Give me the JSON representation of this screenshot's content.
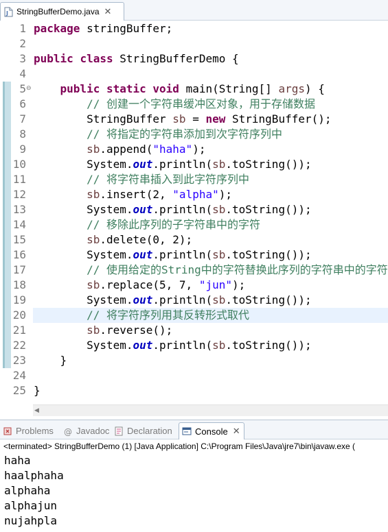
{
  "editor": {
    "tab_title": "StringBufferDemo.java",
    "tab_close": "✕",
    "current_line": 20,
    "lines": [
      [
        {
          "t": "package",
          "c": "kw"
        },
        {
          "t": " stringBuffer;"
        }
      ],
      [],
      [
        {
          "t": "public",
          "c": "kw"
        },
        {
          "t": " "
        },
        {
          "t": "class",
          "c": "kw"
        },
        {
          "t": " StringBufferDemo {"
        }
      ],
      [],
      [
        {
          "t": "    "
        },
        {
          "t": "public",
          "c": "kw"
        },
        {
          "t": " "
        },
        {
          "t": "static",
          "c": "kw"
        },
        {
          "t": " "
        },
        {
          "t": "void",
          "c": "kw"
        },
        {
          "t": " main(String[] "
        },
        {
          "t": "args",
          "c": "var"
        },
        {
          "t": ") {"
        }
      ],
      [
        {
          "t": "        "
        },
        {
          "t": "// 创建一个字符串缓冲区对象，用于存储数据",
          "c": "cm"
        }
      ],
      [
        {
          "t": "        StringBuffer "
        },
        {
          "t": "sb",
          "c": "var"
        },
        {
          "t": " = "
        },
        {
          "t": "new",
          "c": "kw"
        },
        {
          "t": " StringBuffer();"
        }
      ],
      [
        {
          "t": "        "
        },
        {
          "t": "// 将指定的字符串添加到次字符序列中",
          "c": "cm"
        }
      ],
      [
        {
          "t": "        "
        },
        {
          "t": "sb",
          "c": "var"
        },
        {
          "t": ".append("
        },
        {
          "t": "\"haha\"",
          "c": "st"
        },
        {
          "t": ");"
        }
      ],
      [
        {
          "t": "        System."
        },
        {
          "t": "out",
          "c": "fld"
        },
        {
          "t": ".println("
        },
        {
          "t": "sb",
          "c": "var"
        },
        {
          "t": ".toString());"
        }
      ],
      [
        {
          "t": "        "
        },
        {
          "t": "// 将字符串插入到此字符序列中",
          "c": "cm"
        }
      ],
      [
        {
          "t": "        "
        },
        {
          "t": "sb",
          "c": "var"
        },
        {
          "t": ".insert(2, "
        },
        {
          "t": "\"alpha\"",
          "c": "st"
        },
        {
          "t": ");"
        }
      ],
      [
        {
          "t": "        System."
        },
        {
          "t": "out",
          "c": "fld"
        },
        {
          "t": ".println("
        },
        {
          "t": "sb",
          "c": "var"
        },
        {
          "t": ".toString());"
        }
      ],
      [
        {
          "t": "        "
        },
        {
          "t": "// 移除此序列的子字符串中的字符",
          "c": "cm"
        }
      ],
      [
        {
          "t": "        "
        },
        {
          "t": "sb",
          "c": "var"
        },
        {
          "t": ".delete(0, 2);"
        }
      ],
      [
        {
          "t": "        System."
        },
        {
          "t": "out",
          "c": "fld"
        },
        {
          "t": ".println("
        },
        {
          "t": "sb",
          "c": "var"
        },
        {
          "t": ".toString());"
        }
      ],
      [
        {
          "t": "        "
        },
        {
          "t": "// 使用给定的String中的字符替换此序列的字符串中的字符",
          "c": "cm"
        }
      ],
      [
        {
          "t": "        "
        },
        {
          "t": "sb",
          "c": "var"
        },
        {
          "t": ".replace(5, 7, "
        },
        {
          "t": "\"jun\"",
          "c": "st"
        },
        {
          "t": ");"
        }
      ],
      [
        {
          "t": "        System."
        },
        {
          "t": "out",
          "c": "fld"
        },
        {
          "t": ".println("
        },
        {
          "t": "sb",
          "c": "var"
        },
        {
          "t": ".toString());"
        }
      ],
      [
        {
          "t": "        "
        },
        {
          "t": "// 将字符序列用其反转形式取代",
          "c": "cm"
        }
      ],
      [
        {
          "t": "        "
        },
        {
          "t": "sb",
          "c": "var"
        },
        {
          "t": ".reverse();"
        }
      ],
      [
        {
          "t": "        System."
        },
        {
          "t": "out",
          "c": "fld"
        },
        {
          "t": ".println("
        },
        {
          "t": "sb",
          "c": "var"
        },
        {
          "t": ".toString());"
        }
      ],
      [
        {
          "t": "    }"
        }
      ],
      [],
      [
        {
          "t": "}"
        }
      ]
    ]
  },
  "views": {
    "tabs": [
      {
        "label": "Problems",
        "icon": "problems-icon",
        "active": false
      },
      {
        "label": "Javadoc",
        "icon": "javadoc-icon",
        "active": false
      },
      {
        "label": "Declaration",
        "icon": "declaration-icon",
        "active": false
      },
      {
        "label": "Console",
        "icon": "console-icon",
        "active": true
      }
    ],
    "close_glyph": "✕"
  },
  "console": {
    "status": "<terminated> StringBufferDemo (1) [Java Application] C:\\Program Files\\Java\\jre7\\bin\\javaw.exe (",
    "output": [
      "haha",
      "haalphaha",
      "alphaha",
      "alphajun",
      "nujahpla"
    ]
  },
  "colors": {
    "keyword": "#7f0055",
    "comment": "#3f7f5f",
    "string": "#2a00ff",
    "field": "#0000c0",
    "local_var": "#6a3e3e",
    "current_line": "#e8f2fe"
  }
}
